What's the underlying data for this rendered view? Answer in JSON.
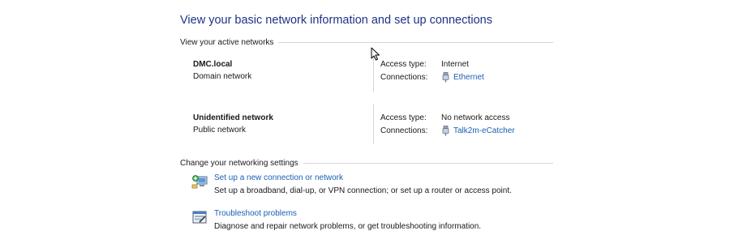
{
  "page": {
    "title": "View your basic network information and set up connections"
  },
  "active_networks": {
    "header": "View your active networks",
    "networks": [
      {
        "name": "DMC.local",
        "type": "Domain network",
        "access_type_label": "Access type:",
        "access_type_value": "Internet",
        "connections_label": "Connections:",
        "connection_name": "Ethernet"
      },
      {
        "name": "Unidentified network",
        "type": "Public network",
        "access_type_label": "Access type:",
        "access_type_value": "No network access",
        "connections_label": "Connections:",
        "connection_name": "Talk2m-eCatcher"
      }
    ]
  },
  "change_settings": {
    "header": "Change your networking settings",
    "tasks": [
      {
        "link": "Set up a new connection or network",
        "description": "Set up a broadband, dial-up, or VPN connection; or set up a router or access point.",
        "icon": "new-connection-icon"
      },
      {
        "link": "Troubleshoot problems",
        "description": "Diagnose and repair network problems, or get troubleshooting information.",
        "icon": "troubleshoot-icon"
      }
    ]
  },
  "colors": {
    "title": "#1e3287",
    "link": "#1a5fb4",
    "rule": "#d6d6d6"
  }
}
